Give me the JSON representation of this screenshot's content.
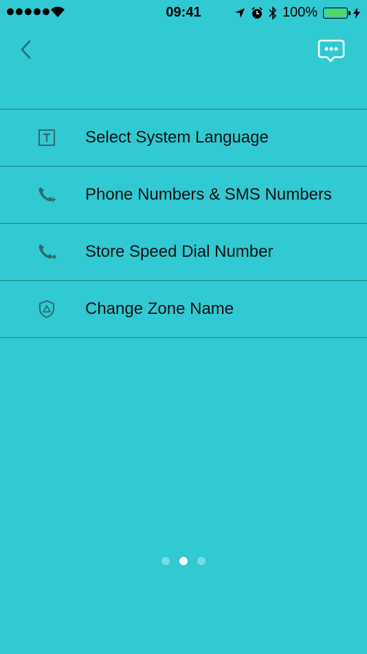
{
  "status_bar": {
    "time": "09:41",
    "battery_percent": "100%",
    "battery_level": 1.0,
    "battery_color": "#4cd964"
  },
  "nav": {
    "back_icon": "chevron-left-icon",
    "chat_icon": "chat-bubble-icon"
  },
  "menu": {
    "items": [
      {
        "label": "Select System Language",
        "icon": "text-language-icon"
      },
      {
        "label": "Phone Numbers & SMS Numbers",
        "icon": "phone-add-icon"
      },
      {
        "label": "Store Speed Dial Number",
        "icon": "phone-forward-icon"
      },
      {
        "label": "Change Zone Name",
        "icon": "shield-zone-icon"
      }
    ]
  },
  "pagination": {
    "total": 3,
    "current": 2
  },
  "colors": {
    "background": "#31c9d2",
    "divider": "#25807f",
    "icon": "#2d6a70",
    "text": "#111111"
  }
}
